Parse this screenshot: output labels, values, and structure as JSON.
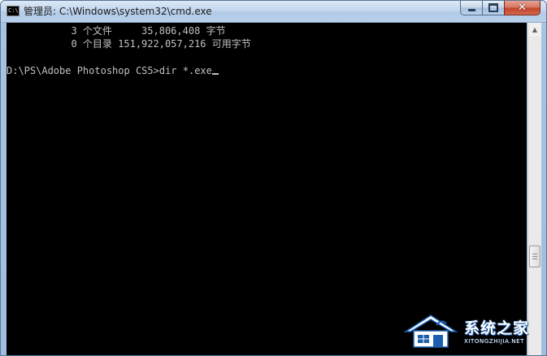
{
  "window": {
    "title": "管理员: C:\\Windows\\system32\\cmd.exe",
    "icon": "cmd-icon",
    "icon_text": "C:\\"
  },
  "captions": {
    "close_glyph": "✕"
  },
  "console": {
    "lines": [
      "           3 个文件     35,806,408 字节",
      "           0 个目录 151,922,057,216 可用字节",
      "",
      "D:\\PS\\Adobe Photoshop CS5>dir *.exe"
    ],
    "text_color": "#c0c0c0",
    "background": "#000000"
  },
  "scrollbar": {
    "up_arrow": "▲"
  },
  "watermark": {
    "text": "系统之家",
    "subtext": "XITONGZHIJIA.NET",
    "color": "#1c5fb0"
  }
}
